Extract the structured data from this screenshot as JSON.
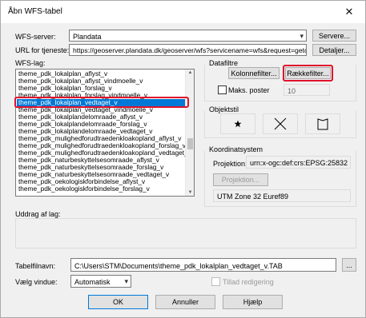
{
  "window": {
    "title": "Åbn WFS-tabel",
    "close_glyph": "✕"
  },
  "server": {
    "label": "WFS-server:",
    "value": "Plandata",
    "button": "Servere..."
  },
  "url": {
    "label": "URL for tjeneste:",
    "value": "https://geoserver.plandata.dk/geoserver/wfs?servicename=wfs&request=getc",
    "button": "Detaljer..."
  },
  "layers": {
    "label": "WFS-lag:",
    "items": [
      "theme_pdk_lokalplan_aflyst_v",
      "theme_pdk_lokalplan_aflyst_vindmoelle_v",
      "theme_pdk_lokalplan_forslag_v",
      "theme_pdk_lokalplan_forslag_vindmoelle_v",
      "theme_pdk_lokalplan_vedtaget_v",
      "theme_pdk_lokalplan_vedtaget_vindmoelle_v",
      "theme_pdk_lokalplandelomraade_aflyst_v",
      "theme_pdk_lokalplandelomraade_forslag_v",
      "theme_pdk_lokalplandelomraade_vedtaget_v",
      "theme_pdk_mulighedforudtraedenkloakopland_aflyst_v",
      "theme_pdk_mulighedforudtraedenkloakopland_forslag_v",
      "theme_pdk_mulighedforudtraedenkloakopland_vedtaget_",
      "theme_pdk_naturbeskyttelsesomraade_aflyst_v",
      "theme_pdk_naturbeskyttelsesomraade_forslag_v",
      "theme_pdk_naturbeskyttelsesomraade_vedtaget_v",
      "theme_pdk_oekologiskforbindelse_aflyst_v",
      "theme_pdk_oekologiskforbindelse_forslag_v"
    ],
    "selected_index": 4
  },
  "filters": {
    "title": "Datafiltre",
    "column_button": "Kolonnefilter...",
    "row_button": "Rækkefilter...",
    "max_posts_label": "Maks. poster",
    "max_posts_value": "10"
  },
  "object_style": {
    "title": "Objektstil"
  },
  "coords": {
    "title": "Koordinatsystem",
    "projection_label": "Projektion:",
    "projection_value": "urn:x-ogc:def:crs:EPSG:25832",
    "projection_button": "Projektion...",
    "system_name": "UTM Zone 32 Euref89"
  },
  "extract": {
    "label": "Uddrag af lag:"
  },
  "table_file": {
    "label": "Tabelfilnavn:",
    "value": "C:\\Users\\STM\\Documents\\theme_pdk_lokalplan_vedtaget_v.TAB",
    "browse": "..."
  },
  "view": {
    "label": "Vælg vindue:",
    "value": "Automatisk",
    "allow_edit_label": "Tillad redigering"
  },
  "buttons": {
    "ok": "OK",
    "cancel": "Annuller",
    "help": "Hjælp"
  },
  "colors": {
    "accent": "#0078d7",
    "highlight": "#e0102a"
  }
}
